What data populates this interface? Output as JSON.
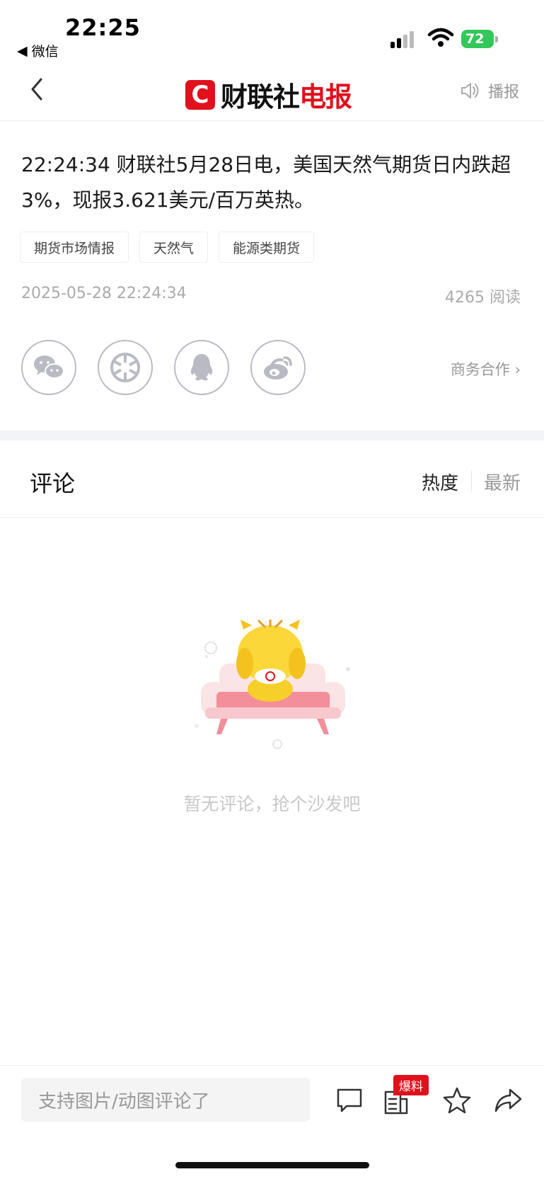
{
  "status_bar": {
    "time": "22:25",
    "back_app": "微信",
    "battery": "72"
  },
  "nav": {
    "logo_letter": "C",
    "logo_black": "财联社",
    "logo_red": "电报",
    "broadcast_label": "播报"
  },
  "article": {
    "headline": "22:24:34 财联社5月28日电，美国天然气期货日内跌超3%，现报3.621美元/百万英热。",
    "tags": [
      "期货市场情报",
      "天然气",
      "能源类期货"
    ],
    "datetime": "2025-05-28 22:24:34",
    "reads": "4265 阅读",
    "share_icons": [
      "wechat-icon",
      "moments-icon",
      "qq-icon",
      "weibo-icon"
    ],
    "business_link": "商务合作 ›"
  },
  "comments": {
    "title": "评论",
    "sort_hot": "热度",
    "sort_new": "最新",
    "empty_text": "暂无评论，抢个沙发吧"
  },
  "bottom_bar": {
    "input_placeholder": "支持图片/动图评论了",
    "badge": "爆料",
    "icons": [
      "comment-icon",
      "report-icon",
      "star-icon",
      "share-icon"
    ]
  },
  "colors": {
    "brand_red": "#e0101d",
    "battery_green": "#34c759",
    "icon_gray": "#b9bac3"
  }
}
